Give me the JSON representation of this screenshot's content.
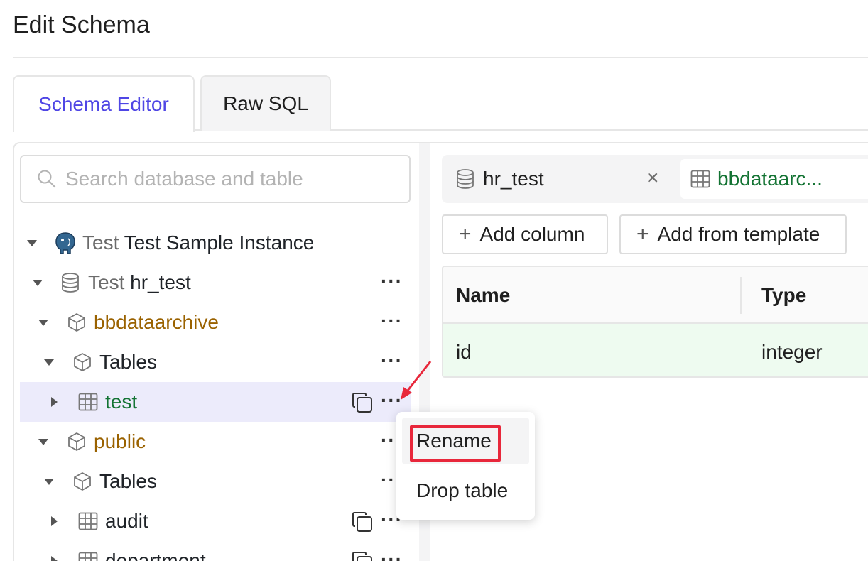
{
  "page": {
    "title": "Edit Schema"
  },
  "tabs": [
    {
      "label": "Schema Editor",
      "active": true
    },
    {
      "label": "Raw SQL",
      "active": false
    }
  ],
  "search": {
    "placeholder": "Search database and table"
  },
  "tree": {
    "instance": {
      "engine": "Test",
      "name": "Test Sample Instance"
    },
    "database": {
      "env": "Test",
      "name": "hr_test"
    },
    "schemas": [
      {
        "name": "bbdataarchive",
        "folder_label": "Tables",
        "tables": [
          {
            "name": "test",
            "selected": true
          }
        ]
      },
      {
        "name": "public",
        "folder_label": "Tables",
        "tables": [
          {
            "name": "audit"
          },
          {
            "name": "department"
          }
        ]
      }
    ]
  },
  "context_menu": {
    "items": [
      {
        "label": "Rename",
        "highlighted": true
      },
      {
        "label": "Drop table"
      }
    ]
  },
  "editor": {
    "tabs": {
      "database": "hr_test",
      "close": "×",
      "table": "bbdataarc..."
    },
    "toolbar": {
      "add_column": "Add column",
      "add_from_template": "Add from template",
      "plus": "+"
    },
    "grid": {
      "headers": [
        "Name",
        "Type"
      ],
      "rows": [
        [
          "id",
          "integer"
        ]
      ]
    }
  },
  "colors": {
    "accent": "#4f46e5",
    "schema": "#9a6200",
    "table": "#137333",
    "highlight": "#e8273b",
    "new_row": "#eefbf0"
  }
}
